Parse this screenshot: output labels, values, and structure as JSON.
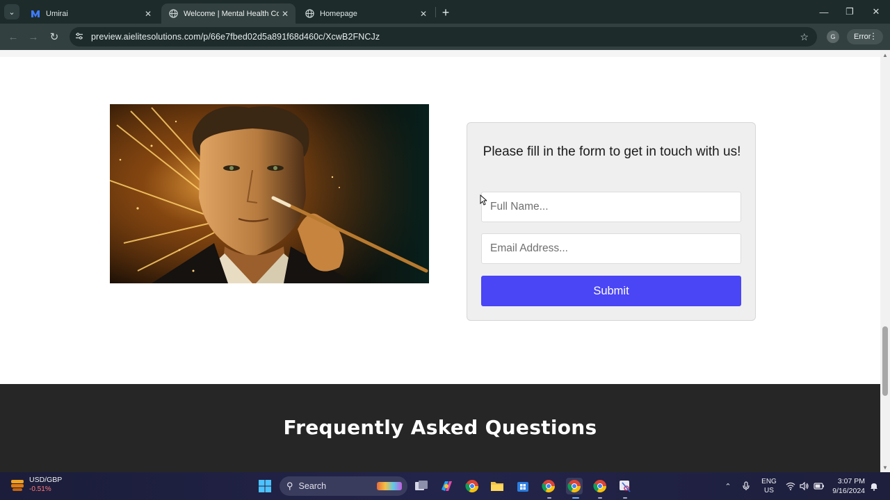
{
  "browser": {
    "tabs": [
      {
        "title": "Umirai",
        "favicon": "umirai-icon",
        "active": false
      },
      {
        "title": "Welcome | Mental Health Coach",
        "favicon": "globe-icon",
        "active": true
      },
      {
        "title": "Homepage",
        "favicon": "globe-icon",
        "active": false
      }
    ],
    "url": "preview.aielitesolutions.com/p/66e7fbed02d5a891f68d460c/XcwB2FNCJz",
    "profile_initial": "G",
    "error_label": "Error"
  },
  "page": {
    "form": {
      "heading": "Please fill in the form to get in touch with us!",
      "full_name_placeholder": "Full Name...",
      "email_placeholder": "Email Address...",
      "submit_label": "Submit"
    },
    "faq_heading": "Frequently Asked Questions"
  },
  "taskbar": {
    "widget": {
      "title": "USD/GBP",
      "change": "-0.51%"
    },
    "search_label": "Search",
    "lang_line1": "ENG",
    "lang_line2": "US",
    "time": "3:07 PM",
    "date": "9/16/2024"
  },
  "colors": {
    "submit_button": "#4a45f5",
    "faq_background": "#262626",
    "chrome_dark": "#1d2b2b",
    "chrome_toolbar": "#32403f"
  }
}
